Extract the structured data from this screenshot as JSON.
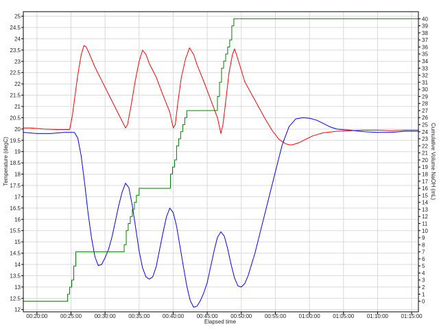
{
  "chart_data": {
    "type": "line",
    "xlabel": "Elapsed time",
    "ylabel_left": "Temperature (degC)",
    "ylabel_right": "Cumulative Volume NaOH (mL)",
    "xlim_minutes": [
      18,
      76
    ],
    "ylim_left": [
      11.9,
      25.2
    ],
    "ylim_right": [
      -1.5,
      41
    ],
    "grid": true,
    "x_ticks": [
      {
        "minutes": 20,
        "label": "00:20:00"
      },
      {
        "minutes": 25,
        "label": "00:25:00"
      },
      {
        "minutes": 30,
        "label": "00:30:00"
      },
      {
        "minutes": 35,
        "label": "00:35:00"
      },
      {
        "minutes": 40,
        "label": "00:40:00"
      },
      {
        "minutes": 45,
        "label": "00:45:00"
      },
      {
        "minutes": 50,
        "label": "00:50:00"
      },
      {
        "minutes": 55,
        "label": "00:55:00"
      },
      {
        "minutes": 60,
        "label": "01:00:00"
      },
      {
        "minutes": 65,
        "label": "01:05:00"
      },
      {
        "minutes": 70,
        "label": "01:10:00"
      },
      {
        "minutes": 75,
        "label": "01:15:00"
      }
    ],
    "y_left_ticks": [
      "12",
      "12.5",
      "13",
      "13.5",
      "14",
      "14.5",
      "15",
      "15.5",
      "16",
      "16.5",
      "17",
      "17.5",
      "18",
      "18.5",
      "19",
      "19.5",
      "20",
      "20.5",
      "21",
      "21.5",
      "22",
      "22.5",
      "23",
      "23.5",
      "24",
      "24.5",
      "25"
    ],
    "y_right_ticks": [
      "0",
      "1",
      "2",
      "3",
      "4",
      "5",
      "6",
      "7",
      "8",
      "9",
      "10",
      "11",
      "12",
      "13",
      "14",
      "15",
      "16",
      "17",
      "18",
      "19",
      "20",
      "21",
      "22",
      "23",
      "24",
      "25",
      "26",
      "27",
      "28",
      "29",
      "30",
      "31",
      "32",
      "33",
      "34",
      "35",
      "36",
      "37",
      "38",
      "39",
      "40"
    ],
    "series": [
      {
        "axis": "left",
        "color": "#ff0000",
        "x": [
          18,
          19,
          21,
          23,
          24.8,
          25.2,
          26,
          26.5,
          26.9,
          27.2,
          27.6,
          28.5,
          29.5,
          30.5,
          31.5,
          32.5,
          33,
          33.3,
          33.8,
          34.4,
          35,
          35.5,
          36,
          36.5,
          37.5,
          38.5,
          39.5,
          40,
          40.3,
          40.7,
          41.2,
          41.8,
          42.4,
          43,
          43.5,
          44.5,
          45.5,
          46.5,
          47,
          47.3,
          47.7,
          48.2,
          48.7,
          49,
          49.3,
          49.8,
          50.5,
          51.5,
          52.5,
          53.5,
          54.5,
          55.5,
          56.5,
          57,
          57.5,
          58.5,
          59.5,
          60.5,
          62,
          64,
          66,
          68,
          70,
          72,
          74,
          76
        ],
        "y": [
          20.05,
          20.05,
          20.0,
          19.98,
          19.98,
          20.6,
          22.4,
          23.3,
          23.7,
          23.65,
          23.4,
          22.75,
          22.15,
          21.55,
          20.95,
          20.35,
          20.05,
          20.2,
          21.0,
          22.1,
          23.0,
          23.5,
          23.3,
          22.9,
          22.3,
          21.5,
          20.75,
          20.05,
          20.2,
          21.2,
          22.3,
          23.1,
          23.6,
          23.3,
          22.85,
          22.1,
          21.3,
          20.5,
          19.8,
          20.2,
          21.2,
          22.5,
          23.3,
          23.55,
          23.3,
          22.8,
          22.1,
          21.55,
          21.0,
          20.45,
          19.95,
          19.55,
          19.35,
          19.3,
          19.3,
          19.4,
          19.55,
          19.7,
          19.83,
          19.9,
          19.93,
          19.95,
          19.95,
          19.93,
          19.95,
          19.95
        ]
      },
      {
        "axis": "left",
        "color": "#0000ff",
        "x": [
          18,
          20,
          22,
          24,
          25.5,
          26,
          26.5,
          27,
          27.5,
          28,
          28.5,
          29,
          29.5,
          30,
          30.5,
          31,
          31.5,
          32,
          32.5,
          33,
          33.5,
          34,
          34.5,
          35,
          35.5,
          36,
          36.5,
          37,
          37.5,
          38,
          38.5,
          39,
          39.5,
          40,
          40.5,
          41,
          41.5,
          42,
          42.5,
          43,
          43.5,
          44,
          44.5,
          45,
          45.5,
          46,
          46.5,
          47,
          47.5,
          48,
          48.5,
          49,
          49.5,
          50,
          50.5,
          51,
          52,
          53,
          54,
          55,
          56,
          57,
          58,
          59,
          60,
          61,
          62,
          63,
          64,
          66,
          68,
          70,
          72,
          74,
          76
        ],
        "y": [
          19.85,
          19.8,
          19.8,
          19.85,
          19.85,
          19.6,
          18.8,
          17.6,
          16.3,
          15.2,
          14.35,
          13.95,
          14.0,
          14.3,
          14.65,
          15.2,
          15.9,
          16.6,
          17.2,
          17.6,
          17.4,
          16.6,
          15.6,
          14.6,
          13.85,
          13.45,
          13.35,
          13.45,
          13.9,
          14.65,
          15.4,
          16.1,
          16.5,
          16.3,
          15.7,
          14.8,
          13.9,
          13.05,
          12.4,
          12.1,
          12.15,
          12.4,
          12.75,
          13.2,
          13.9,
          14.6,
          15.2,
          15.45,
          15.25,
          14.7,
          14.0,
          13.4,
          13.05,
          13.0,
          13.15,
          13.5,
          14.5,
          15.7,
          16.9,
          18.1,
          19.3,
          20.1,
          20.45,
          20.5,
          20.48,
          20.4,
          20.25,
          20.1,
          20.0,
          19.95,
          19.88,
          19.85,
          19.85,
          19.9,
          19.9
        ]
      },
      {
        "axis": "right",
        "color": "#008000",
        "x": [
          18,
          24.5,
          24.5,
          24.8,
          24.8,
          25.1,
          25.1,
          25.4,
          25.4,
          25.7,
          25.7,
          32.8,
          32.8,
          33.1,
          33.1,
          33.4,
          33.4,
          33.7,
          33.7,
          34,
          34,
          34.3,
          34.3,
          34.6,
          34.6,
          35,
          35,
          39.6,
          39.6,
          39.9,
          39.9,
          40.2,
          40.2,
          40.5,
          40.5,
          40.8,
          40.8,
          41.1,
          41.1,
          41.4,
          41.4,
          41.7,
          41.7,
          42,
          42,
          46.5,
          46.5,
          46.8,
          46.8,
          47.1,
          47.1,
          47.4,
          47.4,
          47.7,
          47.7,
          48,
          48,
          48.3,
          48.3,
          48.6,
          48.6,
          48.9,
          48.9,
          76
        ],
        "y": [
          0,
          0,
          1,
          1,
          2,
          2,
          3,
          3,
          5,
          5,
          7,
          7,
          8,
          8,
          10,
          10,
          11,
          11,
          12,
          12,
          13,
          13,
          14,
          14,
          15,
          15,
          16,
          16,
          18,
          18,
          19,
          19,
          20,
          20,
          22,
          22,
          23,
          23,
          24,
          24,
          25,
          25,
          26,
          26,
          27,
          27,
          29,
          29,
          31,
          31,
          33,
          33,
          34,
          34,
          35,
          35,
          36,
          36,
          37,
          37,
          39,
          39,
          40,
          40
        ]
      }
    ]
  }
}
